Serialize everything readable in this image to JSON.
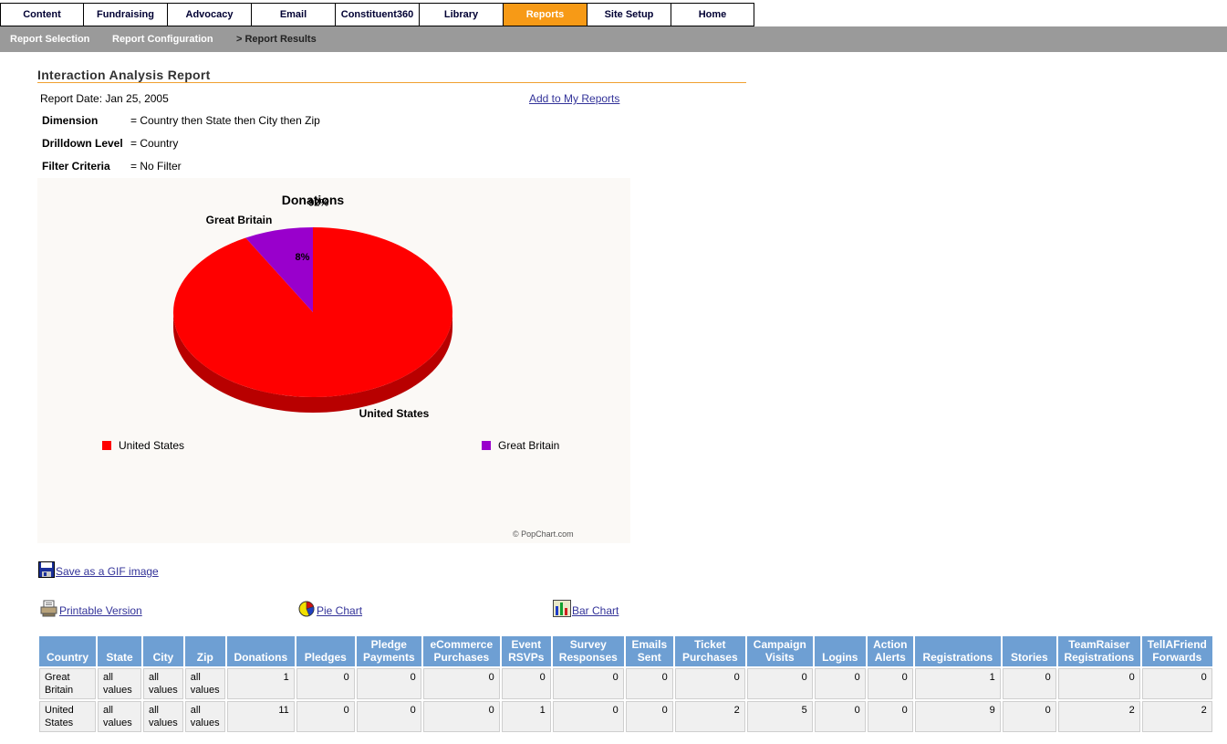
{
  "topnav": [
    {
      "label": "Content",
      "active": false
    },
    {
      "label": "Fundraising",
      "active": false
    },
    {
      "label": "Advocacy",
      "active": false
    },
    {
      "label": "Email",
      "active": false
    },
    {
      "label": "Constituent360",
      "active": false
    },
    {
      "label": "Library",
      "active": false
    },
    {
      "label": "Reports",
      "active": true
    },
    {
      "label": "Site Setup",
      "active": false
    },
    {
      "label": "Home",
      "active": false
    }
  ],
  "subnav": {
    "report_selection": "Report Selection",
    "report_configuration": "Report Configuration",
    "report_results": "> Report Results"
  },
  "page_title": "Interaction Analysis Report",
  "report_date": "Report Date: Jan 25, 2005",
  "add_to_reports": "Add to My Reports",
  "criteria": {
    "dimension_label": "Dimension",
    "dimension_value": "= Country then State then City then Zip",
    "drilldown_label": "Drilldown Level",
    "drilldown_value": "= Country",
    "filter_label": "Filter Criteria",
    "filter_value": "= No Filter"
  },
  "chart_data": {
    "type": "pie",
    "title": "Donations",
    "slices": [
      {
        "label": "United States",
        "value": 92,
        "display": "92%",
        "color": "#FF0000"
      },
      {
        "label": "Great Britain",
        "value": 8,
        "display": "8%",
        "color": "#9900CC"
      }
    ],
    "legend": [
      "United States",
      "Great Britain"
    ],
    "legend_position": "bottom",
    "credit": "© PopChart.com"
  },
  "links": {
    "save_gif": "Save as a GIF image",
    "printable": "Printable Version",
    "pie_chart": "Pie Chart",
    "bar_chart": "Bar Chart"
  },
  "icons": {
    "save": "floppy-disk-icon",
    "printable": "printer-icon",
    "pie": "pie-chart-icon",
    "bar": "bar-chart-icon"
  },
  "table": {
    "columns": [
      [
        "Country"
      ],
      [
        "State"
      ],
      [
        "City"
      ],
      [
        "Zip"
      ],
      [
        "Donations"
      ],
      [
        "Pledges"
      ],
      [
        "Pledge",
        "Payments"
      ],
      [
        "eCommerce",
        "Purchases"
      ],
      [
        "Event",
        "RSVPs"
      ],
      [
        "Survey",
        "Responses"
      ],
      [
        "Emails",
        "Sent"
      ],
      [
        "Ticket",
        "Purchases"
      ],
      [
        "Campaign",
        "Visits"
      ],
      [
        "Logins"
      ],
      [
        "Action",
        "Alerts"
      ],
      [
        "Registrations"
      ],
      [
        "Stories"
      ],
      [
        "TeamRaiser",
        "Registrations"
      ],
      [
        "TellAFriend",
        "Forwards"
      ]
    ],
    "rows": [
      [
        [
          "Great",
          "Britain"
        ],
        [
          "all",
          "values"
        ],
        [
          "all",
          "values"
        ],
        [
          "all",
          "values"
        ],
        "1",
        "0",
        "0",
        "0",
        "0",
        "0",
        "0",
        "0",
        "0",
        "0",
        "0",
        "1",
        "0",
        "0",
        "0"
      ],
      [
        [
          "United",
          "States"
        ],
        [
          "all",
          "values"
        ],
        [
          "all",
          "values"
        ],
        [
          "all",
          "values"
        ],
        "11",
        "0",
        "0",
        "0",
        "1",
        "0",
        "0",
        "2",
        "5",
        "0",
        "0",
        "9",
        "0",
        "2",
        "2"
      ]
    ]
  }
}
